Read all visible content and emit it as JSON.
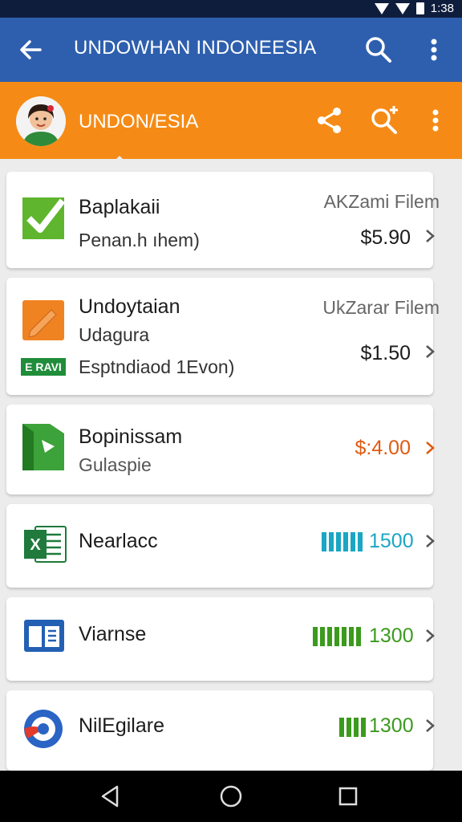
{
  "status_bar": {
    "text": "1:38"
  },
  "app_bar": {
    "title": "UNDOWHAN INDONEESIA"
  },
  "sub_bar": {
    "title": "UNDON/ESIA"
  },
  "items": [
    {
      "name": "Baplakaii",
      "sub": "Penan.h ıhem)",
      "meta": "AKZami Filem",
      "price": "$5.90"
    },
    {
      "name": "Undoytaian",
      "sub": "Udagura",
      "badge": "E RAVI",
      "sub2": "Esptndiaod 1Evon)",
      "meta": "UkZarar Filem",
      "price": "$1.50"
    },
    {
      "name": "Bopinissam",
      "sub": "Gulaspie",
      "price": "$:4.00",
      "price_color": "#e05a10"
    },
    {
      "name": "Nearlacc",
      "value": "1500",
      "value_color": "#1aa6c4",
      "level": 0.6
    },
    {
      "name": "Viarnse",
      "value": "1300",
      "value_color": "#3c9a1e",
      "level": 0.8
    },
    {
      "name": "NilEgilare",
      "value": "1300",
      "value_color": "#3c9a1e",
      "level": 0.4
    }
  ]
}
